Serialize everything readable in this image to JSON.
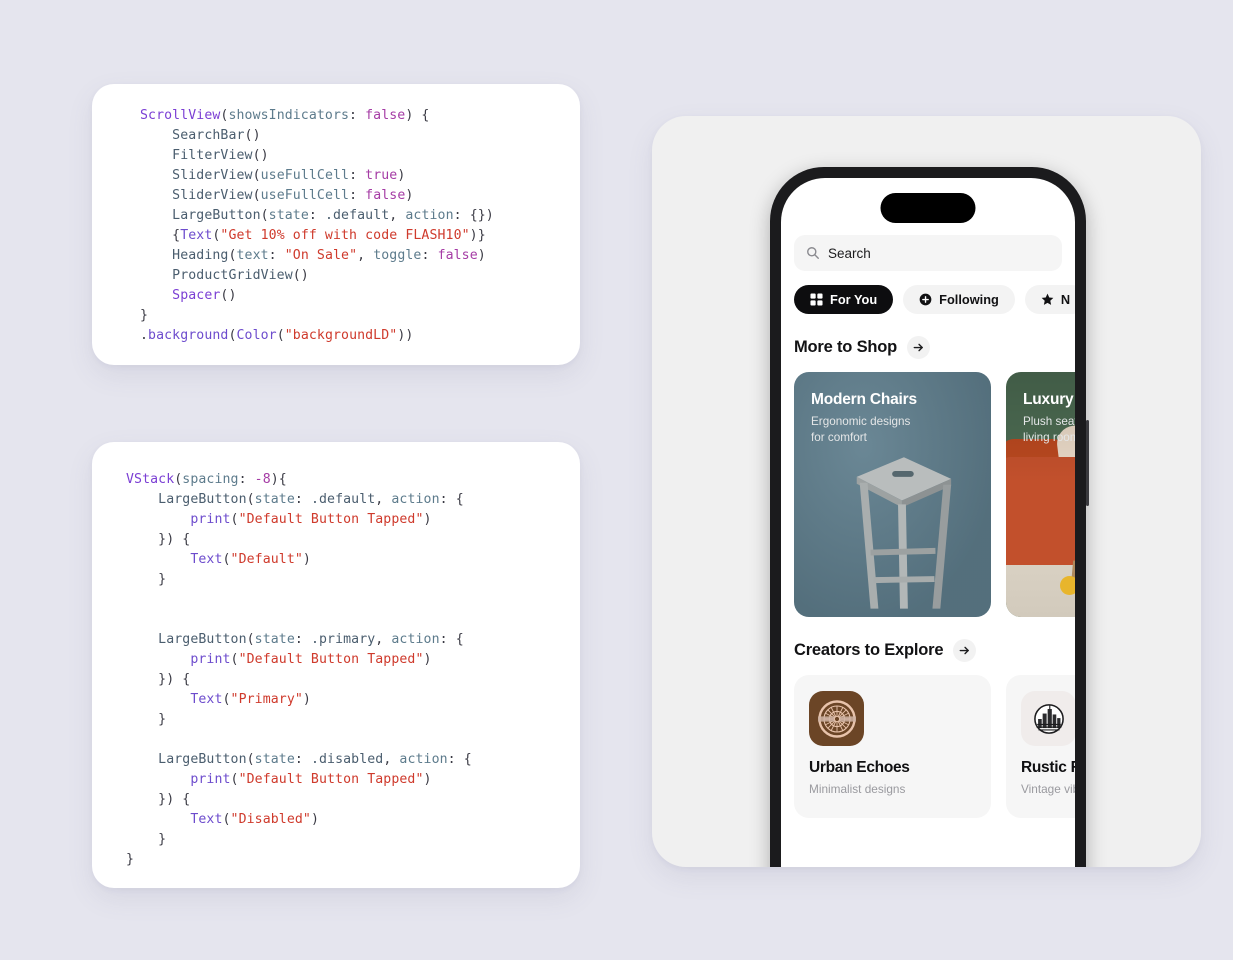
{
  "background_color": "#e5e5ee",
  "code_cards": [
    {
      "id": "scrollview-snippet",
      "lines": [
        [
          {
            "t": "ScrollView",
            "c": "t-type"
          },
          {
            "t": "(",
            "c": "t-punct"
          },
          {
            "t": "showsIndicators",
            "c": "t-param"
          },
          {
            "t": ": ",
            "c": "t-punct"
          },
          {
            "t": "false",
            "c": "t-kw"
          },
          {
            "t": ") {",
            "c": "t-punct"
          }
        ],
        [
          {
            "t": "    ",
            "c": "t-punct"
          },
          {
            "t": "SearchBar",
            "c": "t-comp"
          },
          {
            "t": "()",
            "c": "t-punct"
          }
        ],
        [
          {
            "t": "    ",
            "c": "t-punct"
          },
          {
            "t": "FilterView",
            "c": "t-comp"
          },
          {
            "t": "()",
            "c": "t-punct"
          }
        ],
        [
          {
            "t": "    ",
            "c": "t-punct"
          },
          {
            "t": "SliderView",
            "c": "t-comp"
          },
          {
            "t": "(",
            "c": "t-punct"
          },
          {
            "t": "useFullCell",
            "c": "t-param"
          },
          {
            "t": ": ",
            "c": "t-punct"
          },
          {
            "t": "true",
            "c": "t-kw"
          },
          {
            "t": ")",
            "c": "t-punct"
          }
        ],
        [
          {
            "t": "    ",
            "c": "t-punct"
          },
          {
            "t": "SliderView",
            "c": "t-comp"
          },
          {
            "t": "(",
            "c": "t-punct"
          },
          {
            "t": "useFullCell",
            "c": "t-param"
          },
          {
            "t": ": ",
            "c": "t-punct"
          },
          {
            "t": "false",
            "c": "t-kw"
          },
          {
            "t": ")",
            "c": "t-punct"
          }
        ],
        [
          {
            "t": "    ",
            "c": "t-punct"
          },
          {
            "t": "LargeButton",
            "c": "t-comp"
          },
          {
            "t": "(",
            "c": "t-punct"
          },
          {
            "t": "state",
            "c": "t-param"
          },
          {
            "t": ": ",
            "c": "t-punct"
          },
          {
            "t": ".default",
            "c": "t-member"
          },
          {
            "t": ", ",
            "c": "t-punct"
          },
          {
            "t": "action",
            "c": "t-param"
          },
          {
            "t": ": {})",
            "c": "t-punct"
          }
        ],
        [
          {
            "t": "    {",
            "c": "t-punct"
          },
          {
            "t": "Text",
            "c": "t-fn"
          },
          {
            "t": "(",
            "c": "t-punct"
          },
          {
            "t": "\"Get 10% off with code FLASH10\"",
            "c": "t-str"
          },
          {
            "t": ")}",
            "c": "t-punct"
          }
        ],
        [
          {
            "t": "    ",
            "c": "t-punct"
          },
          {
            "t": "Heading",
            "c": "t-comp"
          },
          {
            "t": "(",
            "c": "t-punct"
          },
          {
            "t": "text",
            "c": "t-param"
          },
          {
            "t": ": ",
            "c": "t-punct"
          },
          {
            "t": "\"On Sale\"",
            "c": "t-str"
          },
          {
            "t": ", ",
            "c": "t-punct"
          },
          {
            "t": "toggle",
            "c": "t-param"
          },
          {
            "t": ": ",
            "c": "t-punct"
          },
          {
            "t": "false",
            "c": "t-kw"
          },
          {
            "t": ")",
            "c": "t-punct"
          }
        ],
        [
          {
            "t": "    ",
            "c": "t-punct"
          },
          {
            "t": "ProductGridView",
            "c": "t-comp"
          },
          {
            "t": "()",
            "c": "t-punct"
          }
        ],
        [
          {
            "t": "    ",
            "c": "t-punct"
          },
          {
            "t": "Spacer",
            "c": "t-type"
          },
          {
            "t": "()",
            "c": "t-punct"
          }
        ],
        [
          {
            "t": "}",
            "c": "t-punct"
          }
        ],
        [
          {
            "t": ".",
            "c": "t-punct"
          },
          {
            "t": "background",
            "c": "t-fn"
          },
          {
            "t": "(",
            "c": "t-punct"
          },
          {
            "t": "Color",
            "c": "t-fn"
          },
          {
            "t": "(",
            "c": "t-punct"
          },
          {
            "t": "\"backgroundLD\"",
            "c": "t-str"
          },
          {
            "t": "))",
            "c": "t-punct"
          }
        ]
      ]
    },
    {
      "id": "largebutton-states-snippet",
      "lines": [
        [
          {
            "t": "VStack",
            "c": "t-type"
          },
          {
            "t": "(",
            "c": "t-punct"
          },
          {
            "t": "spacing",
            "c": "t-param"
          },
          {
            "t": ": ",
            "c": "t-punct"
          },
          {
            "t": "-8",
            "c": "t-num"
          },
          {
            "t": "){",
            "c": "t-punct"
          }
        ],
        [
          {
            "t": "    ",
            "c": "t-punct"
          },
          {
            "t": "LargeButton",
            "c": "t-comp"
          },
          {
            "t": "(",
            "c": "t-punct"
          },
          {
            "t": "state",
            "c": "t-param"
          },
          {
            "t": ": ",
            "c": "t-punct"
          },
          {
            "t": ".default",
            "c": "t-member"
          },
          {
            "t": ", ",
            "c": "t-punct"
          },
          {
            "t": "action",
            "c": "t-param"
          },
          {
            "t": ": {",
            "c": "t-punct"
          }
        ],
        [
          {
            "t": "        ",
            "c": "t-punct"
          },
          {
            "t": "print",
            "c": "t-fn"
          },
          {
            "t": "(",
            "c": "t-punct"
          },
          {
            "t": "\"Default Button Tapped\"",
            "c": "t-str"
          },
          {
            "t": ")",
            "c": "t-punct"
          }
        ],
        [
          {
            "t": "    }) {",
            "c": "t-punct"
          }
        ],
        [
          {
            "t": "        ",
            "c": "t-punct"
          },
          {
            "t": "Text",
            "c": "t-fn"
          },
          {
            "t": "(",
            "c": "t-punct"
          },
          {
            "t": "\"Default\"",
            "c": "t-str"
          },
          {
            "t": ")",
            "c": "t-punct"
          }
        ],
        [
          {
            "t": "    }",
            "c": "t-punct"
          }
        ],
        [
          {
            "t": "",
            "c": "t-punct"
          }
        ],
        [
          {
            "t": "",
            "c": "t-punct"
          }
        ],
        [
          {
            "t": "    ",
            "c": "t-punct"
          },
          {
            "t": "LargeButton",
            "c": "t-comp"
          },
          {
            "t": "(",
            "c": "t-punct"
          },
          {
            "t": "state",
            "c": "t-param"
          },
          {
            "t": ": ",
            "c": "t-punct"
          },
          {
            "t": ".primary",
            "c": "t-member"
          },
          {
            "t": ", ",
            "c": "t-punct"
          },
          {
            "t": "action",
            "c": "t-param"
          },
          {
            "t": ": {",
            "c": "t-punct"
          }
        ],
        [
          {
            "t": "        ",
            "c": "t-punct"
          },
          {
            "t": "print",
            "c": "t-fn"
          },
          {
            "t": "(",
            "c": "t-punct"
          },
          {
            "t": "\"Default Button Tapped\"",
            "c": "t-str"
          },
          {
            "t": ")",
            "c": "t-punct"
          }
        ],
        [
          {
            "t": "    }) {",
            "c": "t-punct"
          }
        ],
        [
          {
            "t": "        ",
            "c": "t-punct"
          },
          {
            "t": "Text",
            "c": "t-fn"
          },
          {
            "t": "(",
            "c": "t-punct"
          },
          {
            "t": "\"Primary\"",
            "c": "t-str"
          },
          {
            "t": ")",
            "c": "t-punct"
          }
        ],
        [
          {
            "t": "    }",
            "c": "t-punct"
          }
        ],
        [
          {
            "t": "",
            "c": "t-punct"
          }
        ],
        [
          {
            "t": "    ",
            "c": "t-punct"
          },
          {
            "t": "LargeButton",
            "c": "t-comp"
          },
          {
            "t": "(",
            "c": "t-punct"
          },
          {
            "t": "state",
            "c": "t-param"
          },
          {
            "t": ": ",
            "c": "t-punct"
          },
          {
            "t": ".disabled",
            "c": "t-member"
          },
          {
            "t": ", ",
            "c": "t-punct"
          },
          {
            "t": "action",
            "c": "t-param"
          },
          {
            "t": ": {",
            "c": "t-punct"
          }
        ],
        [
          {
            "t": "        ",
            "c": "t-punct"
          },
          {
            "t": "print",
            "c": "t-fn"
          },
          {
            "t": "(",
            "c": "t-punct"
          },
          {
            "t": "\"Default Button Tapped\"",
            "c": "t-str"
          },
          {
            "t": ")",
            "c": "t-punct"
          }
        ],
        [
          {
            "t": "    }) {",
            "c": "t-punct"
          }
        ],
        [
          {
            "t": "        ",
            "c": "t-punct"
          },
          {
            "t": "Text",
            "c": "t-fn"
          },
          {
            "t": "(",
            "c": "t-punct"
          },
          {
            "t": "\"Disabled\"",
            "c": "t-str"
          },
          {
            "t": ")",
            "c": "t-punct"
          }
        ],
        [
          {
            "t": "    }",
            "c": "t-punct"
          }
        ],
        [
          {
            "t": "}",
            "c": "t-punct"
          }
        ]
      ]
    }
  ],
  "phone": {
    "search": {
      "value": "Search",
      "icon": "search-icon"
    },
    "filter_chips": [
      {
        "label": "For You",
        "icon": "grid-icon",
        "active": true
      },
      {
        "label": "Following",
        "icon": "plus-circle-icon",
        "active": false
      },
      {
        "label": "N",
        "icon": "star-icon",
        "active": false
      }
    ],
    "sections": [
      {
        "title": "More to Shop",
        "arrow": "arrow-right-icon",
        "cards": [
          {
            "title": "Modern Chairs",
            "subtitle": "Ergonomic designs\nfor comfort",
            "bg_color": "#5f7e8d",
            "art": "wooden-stool"
          },
          {
            "title": "Luxury",
            "subtitle": "Plush seati\nliving room",
            "bg_color": "#4c6b52",
            "art": "orange-sofa"
          }
        ]
      },
      {
        "title": "Creators to Explore",
        "arrow": "arrow-right-icon",
        "creators": [
          {
            "name": "Urban Echoes",
            "desc": "Minimalist designs",
            "avatar_bg": "#6b4526",
            "avatar_icon": "seal-emblem-icon"
          },
          {
            "name": "Rustic Ra",
            "desc": "Vintage vibe",
            "avatar_bg": "#f0ecea",
            "avatar_icon": "city-skyline-icon"
          }
        ]
      }
    ]
  }
}
